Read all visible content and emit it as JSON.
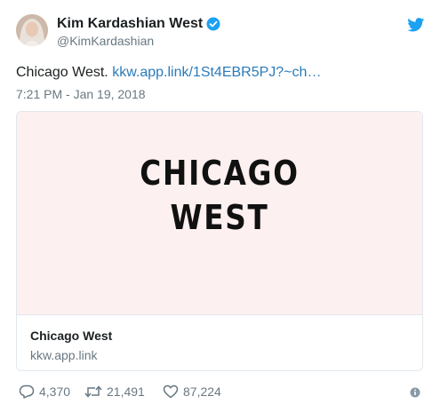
{
  "header": {
    "display_name": "Kim Kardashian West",
    "handle": "@KimKardashian"
  },
  "tweet": {
    "text": "Chicago West.",
    "link": "kkw.app.link/1St4EBR5PJ?~ch…",
    "timestamp": "7:21 PM - Jan 19, 2018"
  },
  "card": {
    "image_line1": "CHICAGO",
    "image_line2": "WEST",
    "title": "Chicago West",
    "domain": "kkw.app.link"
  },
  "actions": {
    "replies": "4,370",
    "retweets": "21,491",
    "likes": "87,224"
  },
  "colors": {
    "accent": "#1da1f2",
    "link": "#2b7bb9",
    "muted": "#697882",
    "card_bg": "#fdf0f0"
  },
  "icons": [
    "verified-badge-icon",
    "twitter-bird-icon",
    "reply-icon",
    "retweet-icon",
    "heart-icon",
    "info-icon"
  ]
}
